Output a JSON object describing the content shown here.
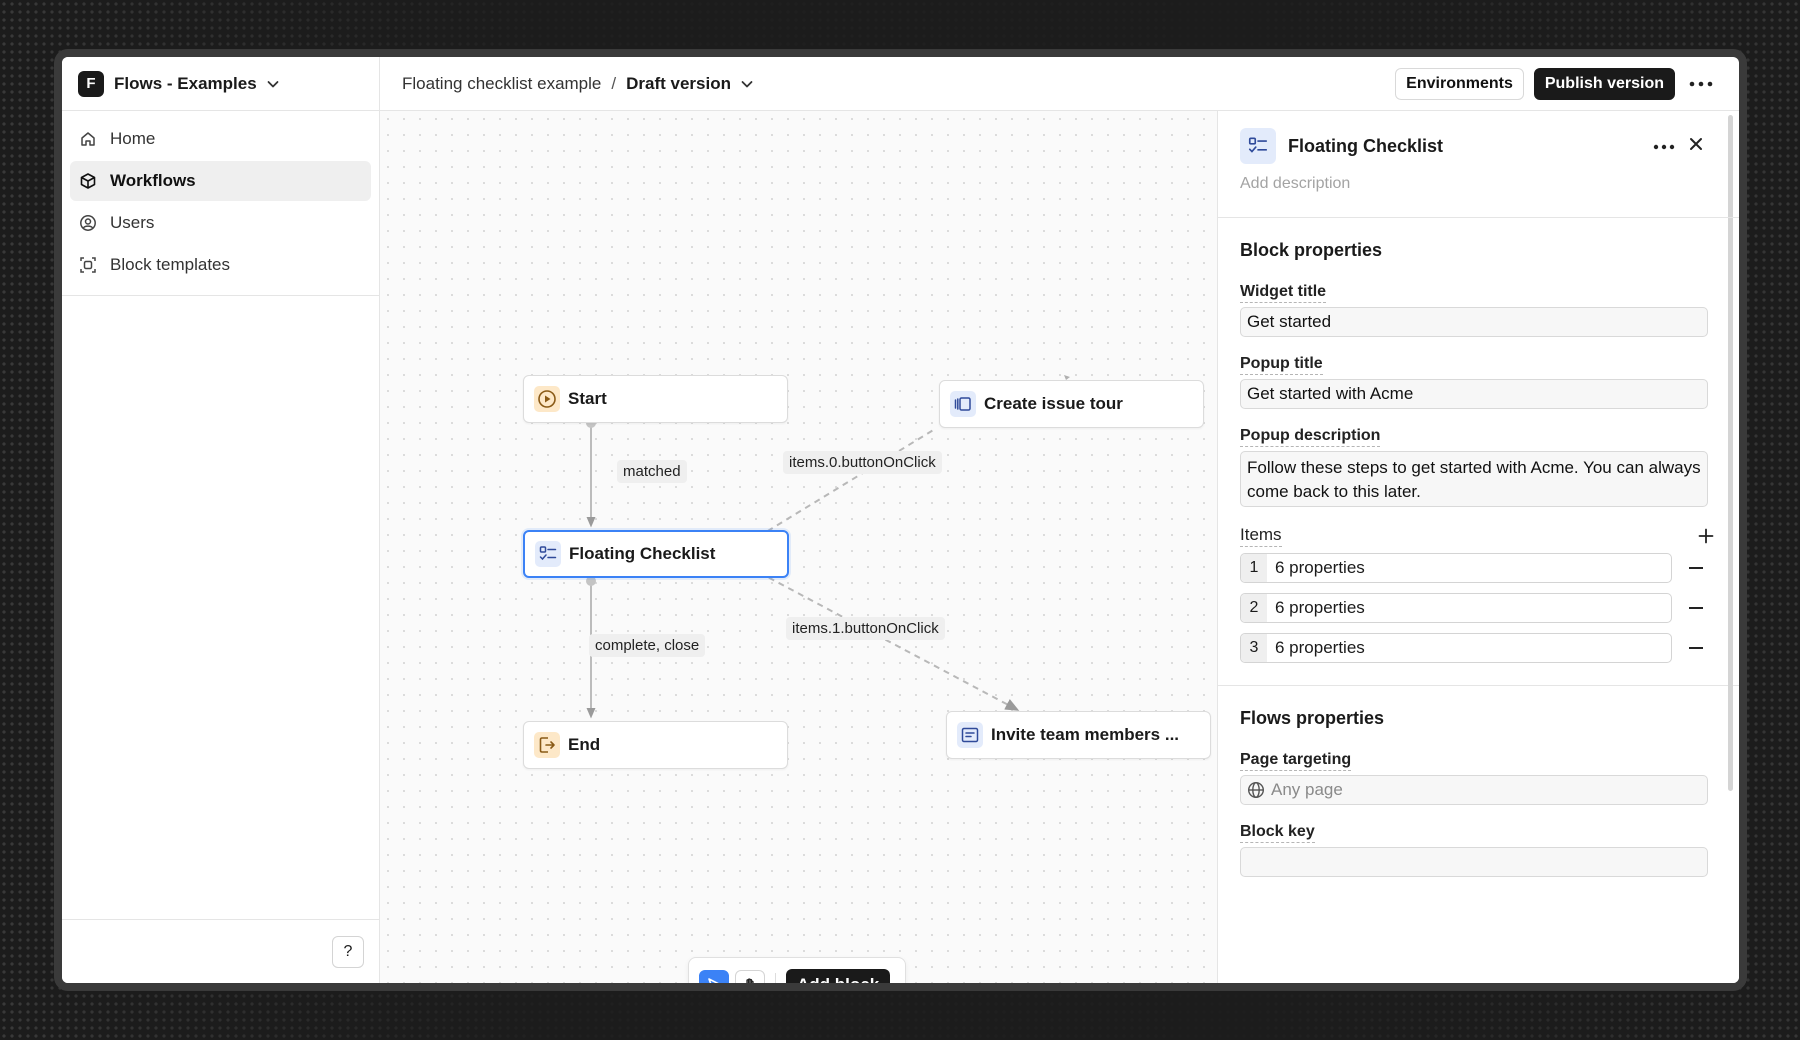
{
  "workspace": {
    "initial": "F",
    "name": "Flows - Examples"
  },
  "sidebar": {
    "items": [
      {
        "label": "Home",
        "icon": "home-icon"
      },
      {
        "label": "Workflows",
        "icon": "cube-icon",
        "active": true
      },
      {
        "label": "Users",
        "icon": "user-circle-icon"
      },
      {
        "label": "Block templates",
        "icon": "template-icon"
      }
    ],
    "help_label": "?"
  },
  "topbar": {
    "breadcrumb_parent": "Floating checklist example",
    "breadcrumb_separator": "/",
    "breadcrumb_current": "Draft version",
    "environments_label": "Environments",
    "publish_label": "Publish version"
  },
  "canvas": {
    "nodes": {
      "start": "Start",
      "floating_checklist": "Floating Checklist",
      "end": "End",
      "create_issue_tour": "Create issue tour",
      "invite_team": "Invite team members ..."
    },
    "edge_labels": {
      "matched": "matched",
      "complete_close": "complete, close",
      "items0": "items.0.buttonOnClick",
      "items1": "items.1.buttonOnClick"
    },
    "toolbar": {
      "add_block_label": "Add block"
    }
  },
  "panel": {
    "title": "Floating Checklist",
    "description_placeholder": "Add description",
    "block_properties": {
      "title": "Block properties",
      "widget_title_label": "Widget title",
      "widget_title_value": "Get started",
      "popup_title_label": "Popup title",
      "popup_title_value": "Get started with Acme",
      "popup_description_label": "Popup description",
      "popup_description_value": "Follow these steps to get started with Acme. You can always come back to this later.",
      "items_label": "Items",
      "items": [
        {
          "index": "1",
          "summary": "6 properties"
        },
        {
          "index": "2",
          "summary": "6 properties"
        },
        {
          "index": "3",
          "summary": "6 properties"
        }
      ]
    },
    "flows_properties": {
      "title": "Flows properties",
      "page_targeting_label": "Page targeting",
      "page_targeting_placeholder": "Any page",
      "block_key_label": "Block key",
      "block_key_value": ""
    }
  },
  "colors": {
    "accent_blue": "#3b82f6",
    "node_orange_bg": "#fde8c8",
    "node_blue_bg": "#e3ebfb",
    "dark": "#1a1a1a"
  }
}
